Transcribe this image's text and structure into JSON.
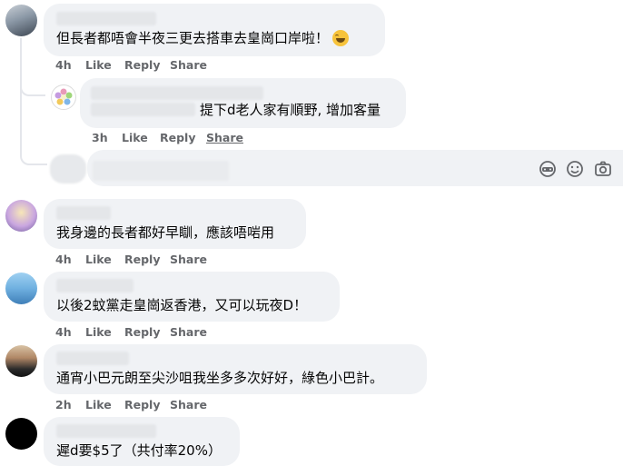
{
  "comments": [
    {
      "text": "但長者都唔會半夜三更去搭車去皇崗口岸啦！",
      "time": "4h",
      "like": "Like",
      "reply": "Reply",
      "share": "Share"
    },
    {
      "text": "我身邊的長者都好早瞓，應該唔啱用",
      "time": "4h",
      "like": "Like",
      "reply": "Reply",
      "share": "Share"
    },
    {
      "text": "以後2蚊黨走皇崗返香港，又可以玩夜D！",
      "time": "4h",
      "like": "Like",
      "reply": "Reply",
      "share": "Share"
    },
    {
      "text": "通宵小巴元朗至尖沙咀我坐多多次好好，綠色小巴計。",
      "time": "2h",
      "like": "Like",
      "reply": "Reply",
      "share": "Share"
    },
    {
      "text": "遲d要$5了（共付率20%）"
    }
  ],
  "reply": {
    "text": "提下d老人家有順野, 增加客量",
    "time": "3h",
    "like": "Like",
    "reply": "Reply",
    "share": "Share"
  },
  "composer": {
    "icons": [
      "gif-icon",
      "emoji-icon",
      "camera-icon"
    ]
  }
}
